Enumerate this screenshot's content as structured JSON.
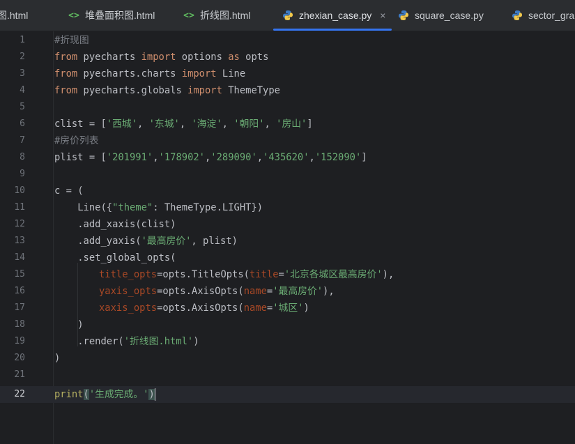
{
  "tabs": [
    {
      "label": "图.html",
      "icon": "html-icon",
      "active": false
    },
    {
      "label": "堆叠面积图.html",
      "icon": "html-icon",
      "active": false
    },
    {
      "label": "折线图.html",
      "icon": "html-icon",
      "active": false
    },
    {
      "label": "zhexian_case.py",
      "icon": "python-icon",
      "active": true
    },
    {
      "label": "square_case.py",
      "icon": "python-icon",
      "active": false
    },
    {
      "label": "sector_grap",
      "icon": "python-icon",
      "active": false
    }
  ],
  "close_glyph": "×",
  "current_line": 22,
  "code": {
    "l1": "#折现图",
    "l2_from": "from",
    "l2_mod": " pyecharts ",
    "l2_import": "import",
    "l2_name": " options ",
    "l2_as": "as",
    "l2_alias": " opts",
    "l3_from": "from",
    "l3_mod": " pyecharts.charts ",
    "l3_import": "import",
    "l3_name": " Line",
    "l4_from": "from",
    "l4_mod": " pyecharts.globals ",
    "l4_import": "import",
    "l4_name": " ThemeType",
    "l6_a": "clist = [",
    "l6_s1": "'西城'",
    "l6_s2": "'东城'",
    "l6_s3": "'海淀'",
    "l6_s4": "'朝阳'",
    "l6_s5": "'房山'",
    "l6_sep": ", ",
    "l6_end": "]",
    "l7": "#房价列表",
    "l8_a": "plist = [",
    "l8_s1": "'201991'",
    "l8_s2": "'178902'",
    "l8_s3": "'289090'",
    "l8_s4": "'435620'",
    "l8_s5": "'152090'",
    "l8_sep": ",",
    "l8_end": "]",
    "l10": "c = (",
    "l11_a": "    Line({",
    "l11_s": "\"theme\"",
    "l11_b": ": ThemeType.LIGHT})",
    "l12": "    .add_xaxis(clist)",
    "l13_a": "    .add_yaxis(",
    "l13_s": "'最高房价'",
    "l13_b": ", plist)",
    "l14": "    .set_global_opts(",
    "l15_p": "title_opts",
    "l15_a": "=opts.TitleOpts(",
    "l15_k": "title",
    "l15_eq": "=",
    "l15_s": "'北京各城区最高房价'",
    "l15_b": "),",
    "l16_p": "yaxis_opts",
    "l16_a": "=opts.AxisOpts(",
    "l16_k": "name",
    "l16_eq": "=",
    "l16_s": "'最高房价'",
    "l16_b": "),",
    "l17_p": "xaxis_opts",
    "l17_a": "=opts.AxisOpts(",
    "l17_k": "name",
    "l17_eq": "=",
    "l17_s": "'城区'",
    "l17_b": ")",
    "l18": "    )",
    "l19_a": "    .render(",
    "l19_s": "'折线图.html'",
    "l19_b": ")",
    "l20": ")",
    "l22_fn": "print",
    "l22_open": "(",
    "l22_s": "'生成完成。'",
    "l22_close": ")"
  },
  "colors": {
    "accent": "#3574f0",
    "keyword": "#cf8e6d",
    "string": "#6aab73",
    "comment": "#7a7e85"
  }
}
